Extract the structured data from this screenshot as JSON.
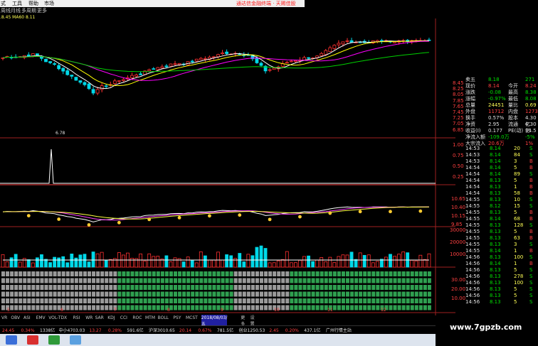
{
  "menu": {
    "items": [
      "式",
      "工具",
      "帮助",
      "市场"
    ],
    "promo": "通达信金融终端 · 天赐佳股"
  },
  "subtabs": [
    "周线",
    "月线",
    "多周期",
    "更多"
  ],
  "ma_legend": ".8.45 MA60 8.11",
  "price_axis": [
    "8.45",
    "8.25",
    "8.05",
    "7.85",
    "7.65",
    "7.45",
    "7.25",
    "7.05",
    "6.85"
  ],
  "annotations": {
    "low_label": "6.78"
  },
  "quote": {
    "rows": [
      {
        "l": "卖五",
        "v": "8.18",
        "l2": "",
        "v2": "271",
        "cls": "c-grn"
      },
      {
        "l": "现价",
        "v": "8.14",
        "l2": "今开",
        "v2": "8.24",
        "cls": "c-red"
      },
      {
        "l": "涨跌",
        "v": "-0.08",
        "l2": "最高",
        "v2": "8.38",
        "cls": "c-grn"
      },
      {
        "l": "涨幅",
        "v": "-0.97%",
        "l2": "最低",
        "v2": "8.08",
        "cls": "c-grn"
      },
      {
        "l": "总量",
        "v": "24451",
        "l2": "量比",
        "v2": "0.69",
        "cls": "c-yel"
      },
      {
        "l": "外盘",
        "v": "11712",
        "l2": "内盘",
        "v2": "12739",
        "cls": "c-red"
      },
      {
        "l": "换手",
        "v": "0.57%",
        "l2": "股本",
        "v2": "4.30亿",
        "cls": "c-wht"
      },
      {
        "l": "净资",
        "v": "2.95",
        "l2": "流通",
        "v2": "4.30亿",
        "cls": "c-wht"
      },
      {
        "l": "收益(I)",
        "v": "0.177",
        "l2": "PE(动)",
        "v2": "34.5",
        "cls": "c-wht"
      },
      {
        "l": "净流入额",
        "v": "-109.0万",
        "l2": "",
        "v2": "-5%",
        "cls": "c-grn"
      },
      {
        "l": "大宗流入",
        "v": "20.6万",
        "l2": "",
        "v2": "1%",
        "cls": "c-red"
      }
    ]
  },
  "ticks": [
    {
      "t": "14:53",
      "p": "8.14",
      "q": "20",
      "s": "S"
    },
    {
      "t": "14:53",
      "p": "8.14",
      "q": "84",
      "s": "S"
    },
    {
      "t": "14:53",
      "p": "8.14",
      "q": "3",
      "s": "B"
    },
    {
      "t": "14:54",
      "p": "8.14",
      "q": "5",
      "s": "B"
    },
    {
      "t": "14:54",
      "p": "8.14",
      "q": "89",
      "s": "S"
    },
    {
      "t": "14:54",
      "p": "8.13",
      "q": "5",
      "s": "B"
    },
    {
      "t": "14:54",
      "p": "8.13",
      "q": "1",
      "s": "B"
    },
    {
      "t": "14:54",
      "p": "8.13",
      "q": "58",
      "s": "B"
    },
    {
      "t": "14:55",
      "p": "8.13",
      "q": "10",
      "s": "S"
    },
    {
      "t": "14:55",
      "p": "8.12",
      "q": "15",
      "s": "S"
    },
    {
      "t": "14:55",
      "p": "8.13",
      "q": "5",
      "s": "B"
    },
    {
      "t": "14:55",
      "p": "8.14",
      "q": "68",
      "s": "B"
    },
    {
      "t": "14:55",
      "p": "8.13",
      "q": "128",
      "s": "S"
    },
    {
      "t": "14:55",
      "p": "8.13",
      "q": "5",
      "s": "B"
    },
    {
      "t": "14:55",
      "p": "8.13",
      "q": "63",
      "s": "B"
    },
    {
      "t": "14:55",
      "p": "8.13",
      "q": "3",
      "s": "S"
    },
    {
      "t": "14:55",
      "p": "8.14",
      "q": "1",
      "s": "B"
    },
    {
      "t": "14:56",
      "p": "8.13",
      "q": "100",
      "s": "S"
    },
    {
      "t": "14:56",
      "p": "8.14",
      "q": "1",
      "s": "B"
    },
    {
      "t": "14:56",
      "p": "8.13",
      "q": "5",
      "s": "S"
    },
    {
      "t": "14:56",
      "p": "8.13",
      "q": "278",
      "s": "S"
    },
    {
      "t": "14:56",
      "p": "8.13",
      "q": "100",
      "s": "S"
    },
    {
      "t": "14:56",
      "p": "8.13",
      "q": "5",
      "s": "S"
    },
    {
      "t": "14:56",
      "p": "8.13",
      "q": "5",
      "s": "S"
    },
    {
      "t": "14:56",
      "p": "8.13",
      "q": "5",
      "s": "S"
    }
  ],
  "panel_axis": {
    "indicator1": [
      "1.00",
      "0.75",
      "0.50",
      "0.25"
    ],
    "indicator2": [
      "10.65",
      "10.40",
      "10.15",
      "9.85"
    ],
    "indicator3": [
      "30000",
      "20000",
      "10000"
    ],
    "indicator4": [
      "30.00",
      "20.00",
      "10.00"
    ]
  },
  "x_labels": [
    "5",
    "6",
    "7",
    "8",
    "9",
    "10",
    "11",
    "12"
  ],
  "bottom_tabs": [
    "VR",
    "OBV",
    "ASI",
    "EMV",
    "VOL-TDX",
    "RSI",
    "WR",
    "SAR",
    "KDJ",
    "CCI",
    "ROC",
    "MTM",
    "BOLL",
    "PSY",
    "MCST",
    "2018/08/03/五",
    "更多",
    "设置"
  ],
  "status": [
    {
      "text": "24.45",
      "cls": "c-red"
    },
    {
      "text": "0.34%",
      "cls": "c-red"
    },
    {
      "text": "1338亿",
      "cls": "c-wht"
    },
    {
      "text": "中小4703.03",
      "cls": "c-wht"
    },
    {
      "text": "13.27",
      "cls": "c-red"
    },
    {
      "text": "0.28%",
      "cls": "c-red"
    },
    {
      "text": "591.6亿",
      "cls": "c-wht"
    },
    {
      "text": "沪深3010.65",
      "cls": "c-wht"
    },
    {
      "text": "20.14",
      "cls": "c-red"
    },
    {
      "text": "0.67%",
      "cls": "c-red"
    },
    {
      "text": "781.5亿",
      "cls": "c-wht"
    },
    {
      "text": "创业1250.53",
      "cls": "c-wht"
    },
    {
      "text": "2.45",
      "cls": "c-red"
    },
    {
      "text": "0.20%",
      "cls": "c-red"
    },
    {
      "text": "437.1亿",
      "cls": "c-wht"
    },
    {
      "text": "广州行情主站",
      "cls": "c-wht"
    }
  ],
  "watermark": "www.7gpzb.com",
  "colors": {
    "up": "#ff3030",
    "down": "#00d8e8",
    "ma5": "#ffffff",
    "ma10": "#ffff00",
    "ma20": "#ff00ff",
    "ma60": "#00d000",
    "ma_long": "#40c040"
  }
}
